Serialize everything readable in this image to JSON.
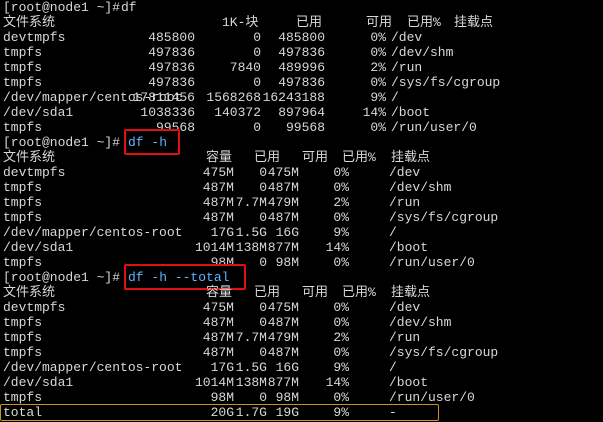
{
  "colors": {
    "background": "#000000",
    "text": "#d8d8d8",
    "command_highlight": "#5fb3ff",
    "annotation_box": "#e01010",
    "total_box": "#c8961e"
  },
  "blocks": [
    {
      "prompt": "[root@node1 ~]#",
      "command": "df",
      "header": [
        "文件系统",
        "1K-块",
        "已用",
        "可用",
        "已用%",
        "挂载点"
      ],
      "rows": [
        [
          "devtmpfs",
          "485800",
          "0",
          "485800",
          "0%",
          "/dev"
        ],
        [
          "tmpfs",
          "497836",
          "0",
          "497836",
          "0%",
          "/dev/shm"
        ],
        [
          "tmpfs",
          "497836",
          "7840",
          "489996",
          "2%",
          "/run"
        ],
        [
          "tmpfs",
          "497836",
          "0",
          "497836",
          "0%",
          "/sys/fs/cgroup"
        ],
        [
          "/dev/mapper/centos-root",
          "17811456",
          "1568268",
          "16243188",
          "9%",
          "/"
        ],
        [
          "/dev/sda1",
          "1038336",
          "140372",
          "897964",
          "14%",
          "/boot"
        ],
        [
          "tmpfs",
          "99568",
          "0",
          "99568",
          "0%",
          "/run/user/0"
        ]
      ]
    },
    {
      "prompt": "[root@node1 ~]#",
      "command": "df -h",
      "header": [
        "文件系统",
        "容量",
        "已用",
        "可用",
        "已用%",
        "挂载点"
      ],
      "rows": [
        [
          "devtmpfs",
          "475M",
          "0",
          "475M",
          "0%",
          "/dev"
        ],
        [
          "tmpfs",
          "487M",
          "0",
          "487M",
          "0%",
          "/dev/shm"
        ],
        [
          "tmpfs",
          "487M",
          "7.7M",
          "479M",
          "2%",
          "/run"
        ],
        [
          "tmpfs",
          "487M",
          "0",
          "487M",
          "0%",
          "/sys/fs/cgroup"
        ],
        [
          "/dev/mapper/centos-root",
          "17G",
          "1.5G",
          "16G",
          "9%",
          "/"
        ],
        [
          "/dev/sda1",
          "1014M",
          "138M",
          "877M",
          "14%",
          "/boot"
        ],
        [
          "tmpfs",
          "98M",
          "0",
          "98M",
          "0%",
          "/run/user/0"
        ]
      ]
    },
    {
      "prompt": "[root@node1 ~]#",
      "command": "df -h --total",
      "header": [
        "文件系统",
        "容量",
        "已用",
        "可用",
        "已用%",
        "挂载点"
      ],
      "rows": [
        [
          "devtmpfs",
          "475M",
          "0",
          "475M",
          "0%",
          "/dev"
        ],
        [
          "tmpfs",
          "487M",
          "0",
          "487M",
          "0%",
          "/dev/shm"
        ],
        [
          "tmpfs",
          "487M",
          "7.7M",
          "479M",
          "2%",
          "/run"
        ],
        [
          "tmpfs",
          "487M",
          "0",
          "487M",
          "0%",
          "/sys/fs/cgroup"
        ],
        [
          "/dev/mapper/centos-root",
          "17G",
          "1.5G",
          "16G",
          "9%",
          "/"
        ],
        [
          "/dev/sda1",
          "1014M",
          "138M",
          "877M",
          "14%",
          "/boot"
        ],
        [
          "tmpfs",
          "98M",
          "0",
          "98M",
          "0%",
          "/run/user/0"
        ],
        [
          "total",
          "20G",
          "1.7G",
          "19G",
          "9%",
          "-"
        ]
      ]
    }
  ]
}
